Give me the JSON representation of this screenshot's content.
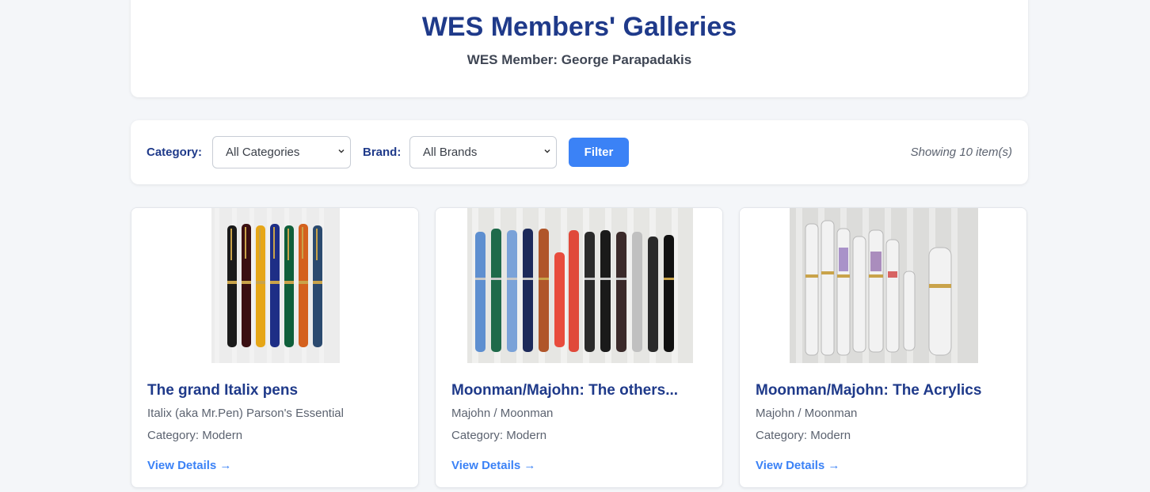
{
  "header": {
    "title": "WES Members' Galleries",
    "member": "WES Member: George Parapadakis"
  },
  "filters": {
    "category_label": "Category:",
    "category_value": "All Categories",
    "brand_label": "Brand:",
    "brand_value": "All Brands",
    "filter_button": "Filter",
    "showing": "Showing 10 item(s)"
  },
  "items": [
    {
      "title": "The grand Italix pens",
      "brand": "Italix (aka Mr.Pen) Parson's Essential",
      "category": "Category: Modern",
      "link": "View Details →"
    },
    {
      "title": "Moonman/Majohn: The others...",
      "brand": "Majohn / Moonman",
      "category": "Category: Modern",
      "link": "View Details →"
    },
    {
      "title": "Moonman/Majohn: The Acrylics",
      "brand": "Majohn / Moonman",
      "category": "Category: Modern",
      "link": "View Details →"
    }
  ],
  "colors": {
    "accent": "#3b82f6",
    "heading": "#1f3a8a",
    "background": "#f4f6f9"
  },
  "icons": {
    "select_chevron": "chevron-down-icon"
  }
}
